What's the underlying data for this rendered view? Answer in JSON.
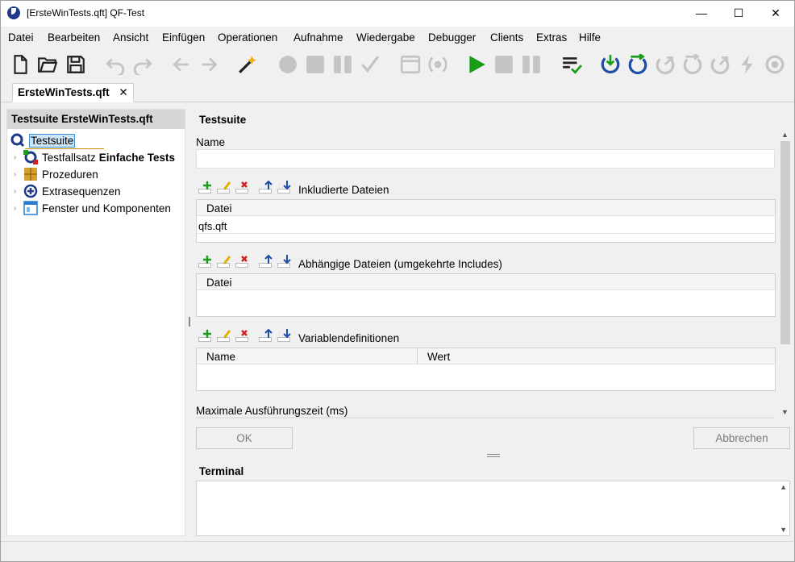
{
  "window": {
    "title": "[ErsteWinTests.qft] QF-Test",
    "minimize_label": "—",
    "maximize_label": "☐",
    "close_label": "✕"
  },
  "menu": {
    "items": [
      "Datei",
      "Bearbeiten",
      "Ansicht",
      "Einfügen",
      "Operationen",
      "Aufnahme",
      "Wiedergabe",
      "Debugger",
      "Clients",
      "Extras",
      "Hilfe"
    ]
  },
  "toolbar": {
    "icons": [
      "new-file-icon",
      "open-folder-icon",
      "save-icon",
      "undo-icon",
      "redo-icon",
      "back-arrow-icon",
      "forward-arrow-icon",
      "magic-wand-icon",
      "record-icon",
      "stop-record-icon",
      "pause-record-icon",
      "check-icon",
      "window-icon",
      "record-component-icon",
      "play-icon",
      "stop-icon",
      "pause-icon",
      "checklist-icon",
      "step-in-icon",
      "step-over-icon",
      "step-out-icon",
      "step-back-icon",
      "continue-icon",
      "skip-icon",
      "breakpoint-icon"
    ],
    "accent_green": "#1a9e1a",
    "accent_blue": "#1f4ea8",
    "disabled_gray": "#c4c4c4"
  },
  "tabs": {
    "active_label": "ErsteWinTests.qft",
    "close_label": "✕"
  },
  "tree": {
    "header": "Testsuite ErsteWinTests.qft",
    "root_label": "Testsuite",
    "nodes": [
      {
        "prefix": "Testfallsatz",
        "bold": "Einfache Tests"
      },
      {
        "prefix": "Prozeduren",
        "bold": ""
      },
      {
        "prefix": "Extrasequenzen",
        "bold": ""
      },
      {
        "prefix": "Fenster und Komponenten",
        "bold": ""
      }
    ]
  },
  "detail": {
    "section_title": "Testsuite",
    "name_label": "Name",
    "name_value": "",
    "included_files_label": "Inkludierte Dateien",
    "included_files_column": "Datei",
    "included_files_rows": [
      "qfs.qft"
    ],
    "dependent_files_label": "Abhängige Dateien (umgekehrte Includes)",
    "dependent_files_column": "Datei",
    "variables_label": "Variablendefinitionen",
    "variables_columns": [
      "Name",
      "Wert"
    ],
    "max_time_label": "Maximale Ausführungszeit (ms)",
    "ok_label": "OK",
    "cancel_label": "Abbrechen",
    "terminal_label": "Terminal"
  }
}
